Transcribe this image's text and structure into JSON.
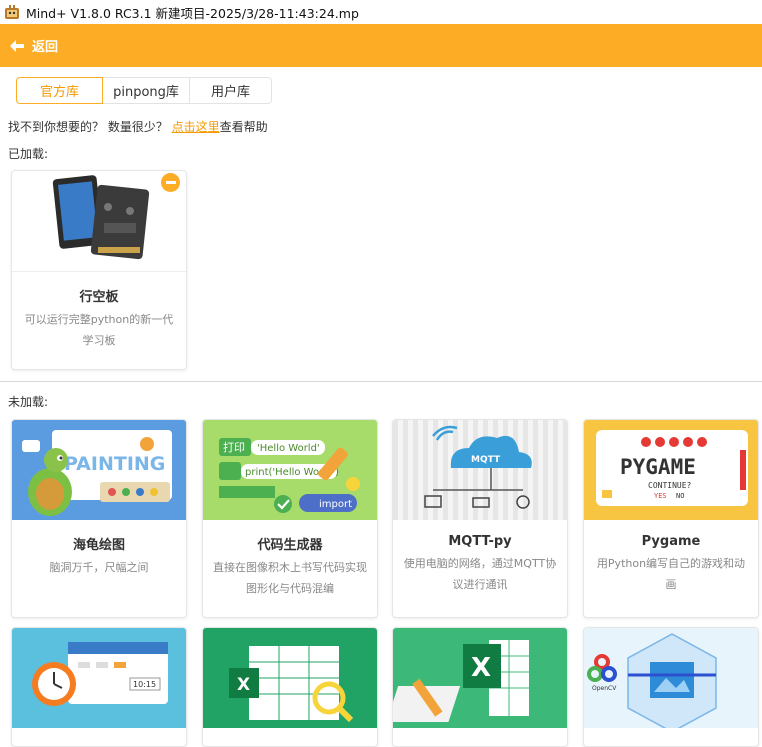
{
  "window": {
    "title": "Mind+ V1.8.0 RC3.1    新建项目-2025/3/28-11:43:24.mp"
  },
  "topbar": {
    "back_label": "返回",
    "color": "#fdad25"
  },
  "tabs": [
    {
      "label": "官方库",
      "active": true
    },
    {
      "label": "pinpong库",
      "active": false
    },
    {
      "label": "用户库",
      "active": false
    }
  ],
  "hint": {
    "text": "找不到你想要的？ 数量很少？",
    "link": "点击这里",
    "suffix": "查看帮助"
  },
  "loaded": {
    "label": "已加载:",
    "cards": [
      {
        "title": "行空板",
        "desc": "可以运行完整python的新一代学习板"
      }
    ]
  },
  "unloaded": {
    "label": "未加载:",
    "cards": [
      {
        "title": "海龟绘图",
        "desc": "脑洞万千，尺幅之间",
        "image_text": "PAINTING"
      },
      {
        "title": "代码生成器",
        "desc": "直接在图像积木上书写代码实现图形化与代码混编",
        "image_text": [
          "打印",
          "'Hello World'",
          "print('Hello World')",
          "import"
        ]
      },
      {
        "title": "MQTT-py",
        "desc": "使用电脑的网络，通过MQTT协议进行通讯",
        "image_text": "MQTT"
      },
      {
        "title": "Pygame",
        "desc": "用Python编写自己的游戏和动画",
        "image_text": [
          "PYGAME",
          "CONTINUE?",
          "YES",
          "NO"
        ]
      }
    ],
    "row2_image_text": {
      "clock": "10:15",
      "opencv": "OpenCV"
    }
  }
}
